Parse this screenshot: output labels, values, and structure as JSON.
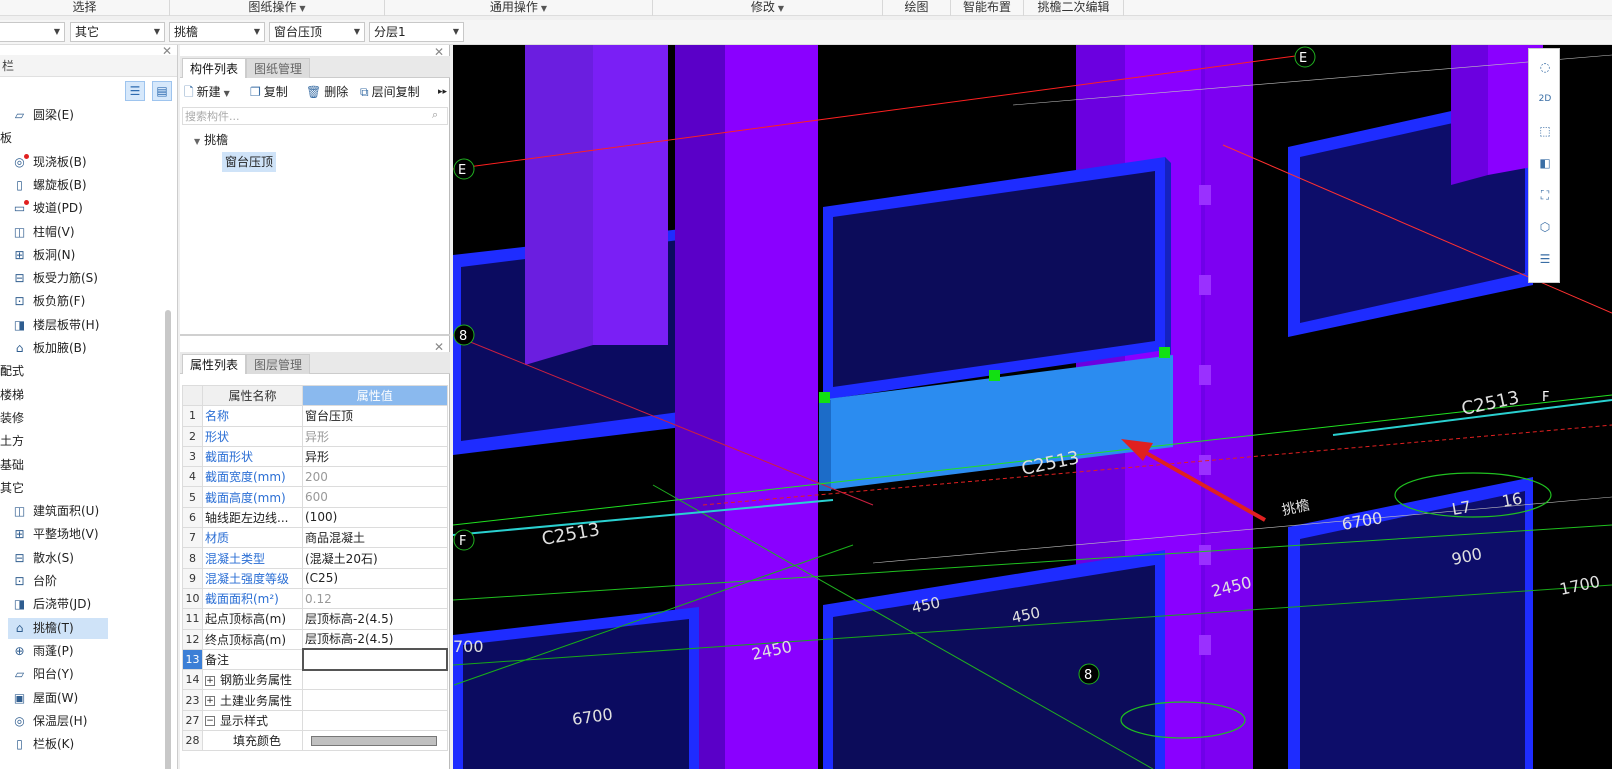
{
  "ribbon": {
    "groups": [
      "选择",
      "图纸操作",
      "通用操作",
      "修改",
      "绘图",
      "智能布置",
      "挑檐二次编辑"
    ]
  },
  "selectors": [
    {
      "value": ""
    },
    {
      "value": "其它"
    },
    {
      "value": "挑檐"
    },
    {
      "value": "窗台压顶"
    },
    {
      "value": "分层1"
    }
  ],
  "leftnav": {
    "header": "栏",
    "items": [
      {
        "label": "圆梁(E)",
        "icon": "beam-icon"
      },
      {
        "label": "板",
        "category": true
      },
      {
        "label": "现浇板(B)",
        "icon": "slab-icon",
        "dot": true
      },
      {
        "label": "螺旋板(B)",
        "icon": "spiral-slab-icon"
      },
      {
        "label": "坡道(PD)",
        "icon": "ramp-icon",
        "dot": true
      },
      {
        "label": "柱帽(V)",
        "icon": "column-cap-icon"
      },
      {
        "label": "板洞(N)",
        "icon": "slab-hole-icon"
      },
      {
        "label": "板受力筋(S)",
        "icon": "rebar-icon"
      },
      {
        "label": "板负筋(F)",
        "icon": "negative-rebar-icon"
      },
      {
        "label": "楼层板带(H)",
        "icon": "slab-strip-icon"
      },
      {
        "label": "板加腋(B)",
        "icon": "haunch-icon"
      },
      {
        "label": "配式",
        "category": true,
        "lock": true
      },
      {
        "label": "楼梯",
        "category": true
      },
      {
        "label": "装修",
        "category": true
      },
      {
        "label": "土方",
        "category": true
      },
      {
        "label": "基础",
        "category": true
      },
      {
        "label": "其它",
        "category": true
      },
      {
        "label": "建筑面积(U)",
        "icon": "area-icon"
      },
      {
        "label": "平整场地(V)",
        "icon": "leveling-icon"
      },
      {
        "label": "散水(S)",
        "icon": "apron-icon"
      },
      {
        "label": "台阶",
        "icon": "steps-icon"
      },
      {
        "label": "后浇带(JD)",
        "icon": "post-pour-icon"
      },
      {
        "label": "挑檐(T)",
        "icon": "eave-icon",
        "selected": true
      },
      {
        "label": "雨蓬(P)",
        "icon": "canopy-icon"
      },
      {
        "label": "阳台(Y)",
        "icon": "balcony-icon"
      },
      {
        "label": "屋面(W)",
        "icon": "roof-icon"
      },
      {
        "label": "保温层(H)",
        "icon": "insulation-icon"
      },
      {
        "label": "栏板(K)",
        "icon": "parapet-icon"
      }
    ]
  },
  "components": {
    "tabs": [
      "构件列表",
      "图纸管理"
    ],
    "toolbar": {
      "new": "新建",
      "copy": "复制",
      "delete": "删除",
      "floor_copy": "层间复制"
    },
    "search_placeholder": "搜索构件...",
    "tree_parent": "挑檐",
    "tree_child": "窗台压顶"
  },
  "properties": {
    "tabs": [
      "属性列表",
      "图层管理"
    ],
    "header_name": "属性名称",
    "header_value": "属性值",
    "rows": [
      {
        "num": "1",
        "name": "名称",
        "value": "窗台压顶",
        "blue": true
      },
      {
        "num": "2",
        "name": "形状",
        "value": "异形",
        "blue": true,
        "grey": true
      },
      {
        "num": "3",
        "name": "截面形状",
        "value": "异形",
        "blue": true
      },
      {
        "num": "4",
        "name": "截面宽度(mm)",
        "value": "200",
        "blue": true,
        "grey": true
      },
      {
        "num": "5",
        "name": "截面高度(mm)",
        "value": "600",
        "blue": true,
        "grey": true
      },
      {
        "num": "6",
        "name": "轴线距左边线...",
        "value": "(100)"
      },
      {
        "num": "7",
        "name": "材质",
        "value": "商品混凝土",
        "blue": true
      },
      {
        "num": "8",
        "name": "混凝土类型",
        "value": "(混凝土20石)",
        "blue": true
      },
      {
        "num": "9",
        "name": "混凝土强度等级",
        "value": "(C25)",
        "blue": true
      },
      {
        "num": "10",
        "name": "截面面积(m²)",
        "value": "0.12",
        "blue": true,
        "grey": true
      },
      {
        "num": "11",
        "name": "起点顶标高(m)",
        "value": "层顶标高-2(4.5)"
      },
      {
        "num": "12",
        "name": "终点顶标高(m)",
        "value": "层顶标高-2(4.5)"
      },
      {
        "num": "13",
        "name": "备注",
        "value": "",
        "active": true
      },
      {
        "num": "14",
        "name": "钢筋业务属性",
        "value": "",
        "expand": "+"
      },
      {
        "num": "23",
        "name": "土建业务属性",
        "value": "",
        "expand": "+"
      },
      {
        "num": "27",
        "name": "显示样式",
        "value": "",
        "expand": "−"
      },
      {
        "num": "28",
        "name": "填充颜色",
        "value": "",
        "indent": true,
        "swatch": true
      }
    ]
  },
  "viewport": {
    "axis_labels": {
      "e_top": "E",
      "e_left": "E",
      "eight_left": "8",
      "f_left": "F",
      "f_right": "F",
      "eight_bottom": "8"
    },
    "annotations": {
      "c2513_center": "C2513",
      "c2513_left": "C2513",
      "c2513_right": "C2513",
      "l7": "L7",
      "dim_6700_right": "6700",
      "dim_900": "900",
      "dim_2450_right": "2450",
      "dim_2450_left": "2450",
      "dim_450_a": "450",
      "dim_450_b": "450",
      "dim_6700_bottom": "6700",
      "dim_700_left": "700",
      "dim_16": "16",
      "dim_1700": "1700",
      "eave_text": "挑檐"
    },
    "colors": {
      "column": "#8a00ff",
      "frame": "#1f2cff",
      "selected": "#2b8cf0",
      "arrow": "#e02020"
    }
  },
  "view_tools": [
    "orbit-icon",
    "2d-icon",
    "3d-box-icon",
    "shaded-box-icon",
    "fit-view-icon",
    "select-view-icon",
    "layer-settings-icon"
  ]
}
